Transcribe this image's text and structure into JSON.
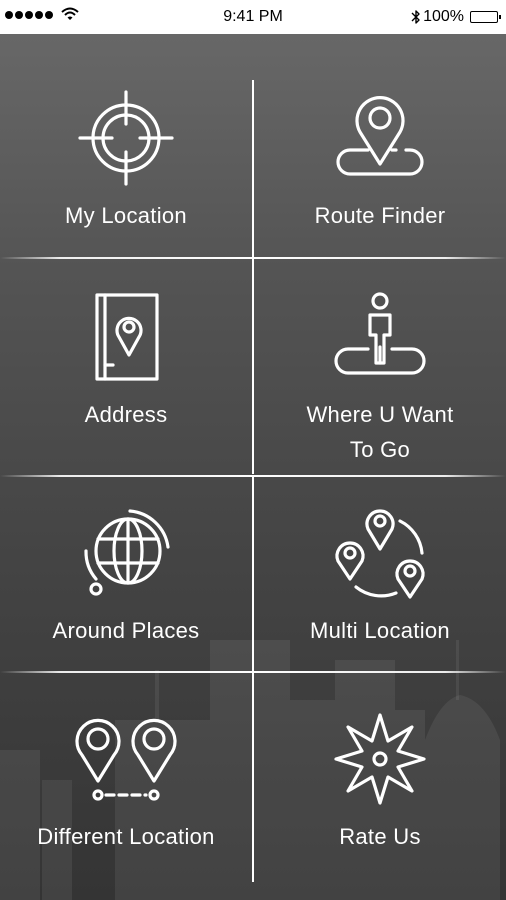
{
  "status_bar": {
    "time": "9:41 PM",
    "battery_percent": "100%",
    "signal_bars": 5,
    "icons": [
      "signal-dots-icon",
      "wifi-icon",
      "bluetooth-icon",
      "battery-icon"
    ]
  },
  "menu": {
    "items": [
      {
        "label": "My Location",
        "icon": "crosshair-icon"
      },
      {
        "label": "Route Finder",
        "icon": "map-pin-route-icon"
      },
      {
        "label": "Address",
        "icon": "address-book-icon"
      },
      {
        "label": "Where U Want\nTo Go",
        "icon": "person-on-platform-icon"
      },
      {
        "label": "Around Places",
        "icon": "globe-icon"
      },
      {
        "label": "Multi Location",
        "icon": "multi-pin-icon"
      },
      {
        "label": "Different Location",
        "icon": "two-pins-icon"
      },
      {
        "label": "Rate Us",
        "icon": "compass-star-icon"
      }
    ]
  },
  "colors": {
    "background_top": "#6a6a6a",
    "background_bottom": "#343434",
    "foreground": "#ffffff"
  }
}
